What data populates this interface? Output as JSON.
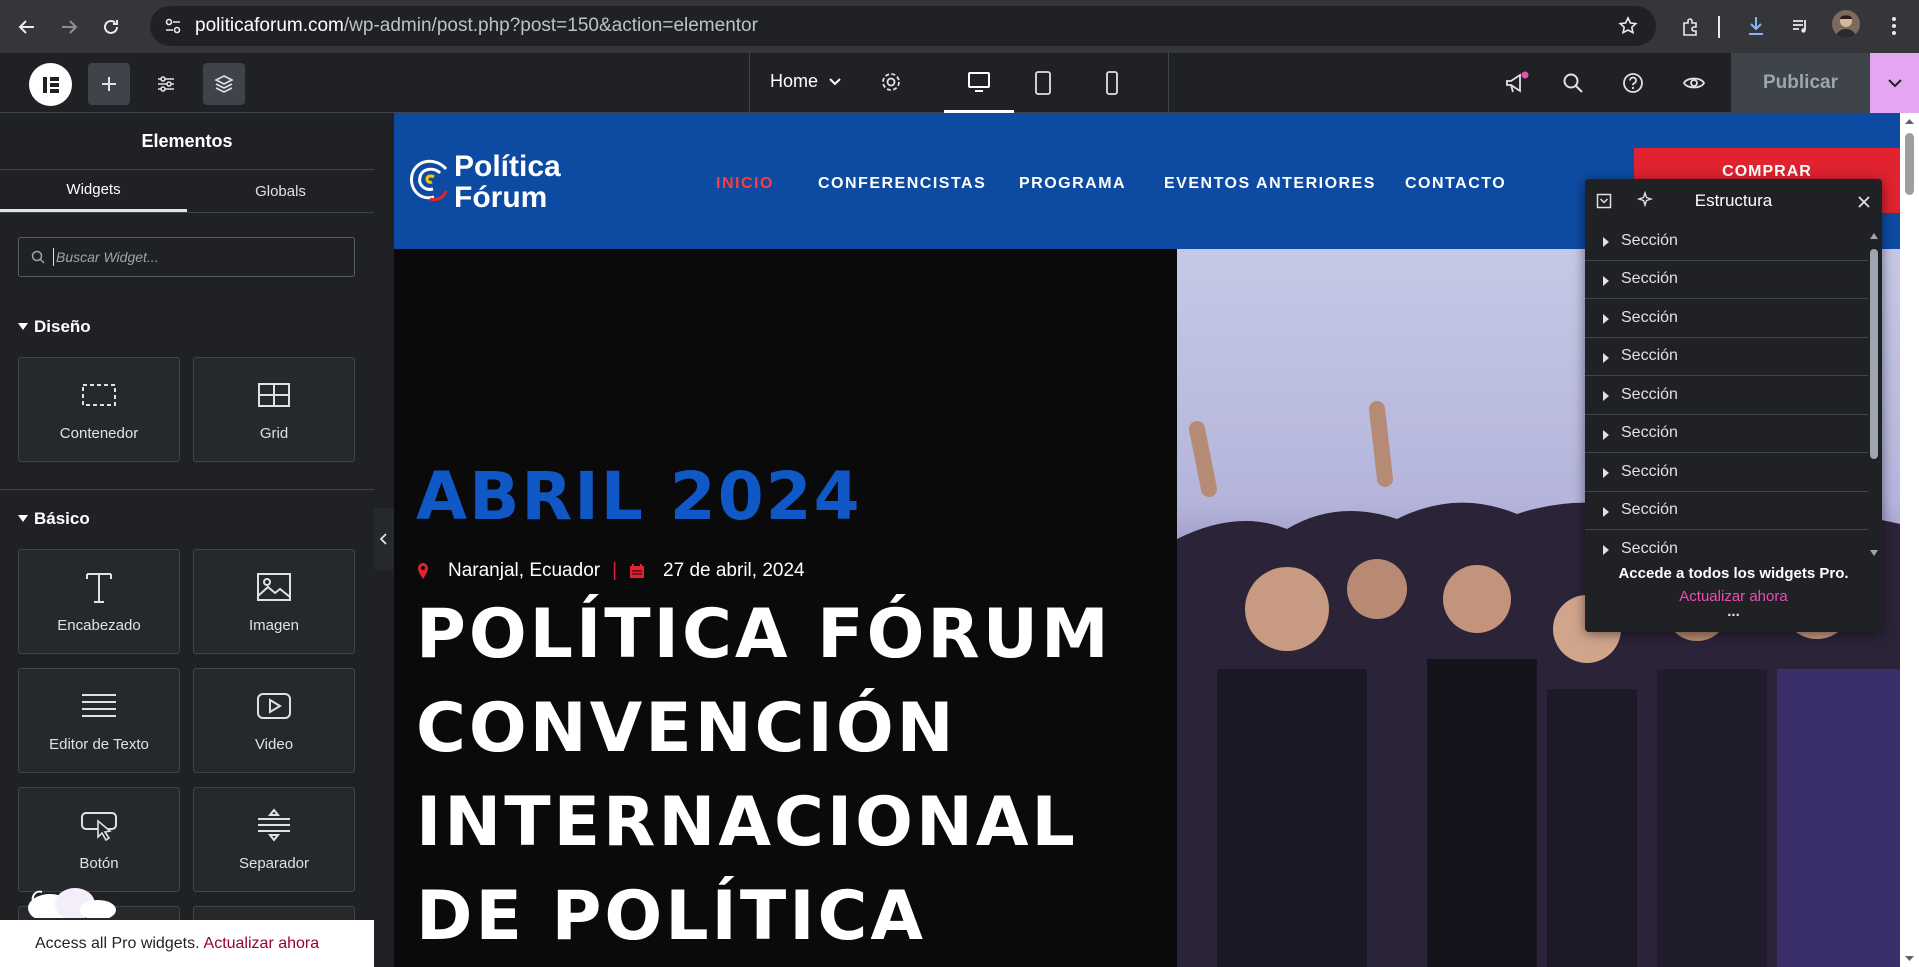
{
  "browser": {
    "url_host": "politicaforum.com",
    "url_path": "/wp-admin/post.php?post=150&action=elementor"
  },
  "editor": {
    "page_name": "Home",
    "publish_label": "Publicar"
  },
  "panel": {
    "title": "Elementos",
    "tabs": [
      "Widgets",
      "Globals"
    ],
    "search_placeholder": "Buscar Widget...",
    "categories": [
      {
        "name": "Diseño",
        "widgets": [
          "Contenedor",
          "Grid"
        ]
      },
      {
        "name": "Básico",
        "widgets": [
          "Encabezado",
          "Imagen",
          "Editor de Texto",
          "Video",
          "Botón",
          "Separador"
        ]
      }
    ],
    "promo_text": "Access all Pro widgets.",
    "promo_link": "Actualizar ahora"
  },
  "site": {
    "logo_line1": "Política",
    "logo_line2": "Fórum",
    "menu": [
      "INICIO",
      "CONFERENCISTAS",
      "PROGRAMA",
      "EVENTOS ANTERIORES",
      "CONTACTO"
    ],
    "buy_label": "COMPRAR",
    "date_heading": "ABRIL 2024",
    "location": "Naranjal, Ecuador",
    "separator": "|",
    "event_date": "27 de abril, 2024",
    "title_lines": [
      "POLÍTICA FÓRUM",
      "CONVENCIÓN",
      "INTERNACIONAL",
      "DE POLÍTICA"
    ]
  },
  "navigator": {
    "title": "Estructura",
    "items": [
      "Sección",
      "Sección",
      "Sección",
      "Sección",
      "Sección",
      "Sección",
      "Sección",
      "Sección",
      "Sección"
    ],
    "footer_text": "Accede a todos los widgets Pro.",
    "footer_link": "Actualizar ahora",
    "more": "..."
  },
  "colors": {
    "header_blue": "#0d4ba3",
    "accent_red": "#e0232e",
    "pink": "#e94eb0"
  }
}
